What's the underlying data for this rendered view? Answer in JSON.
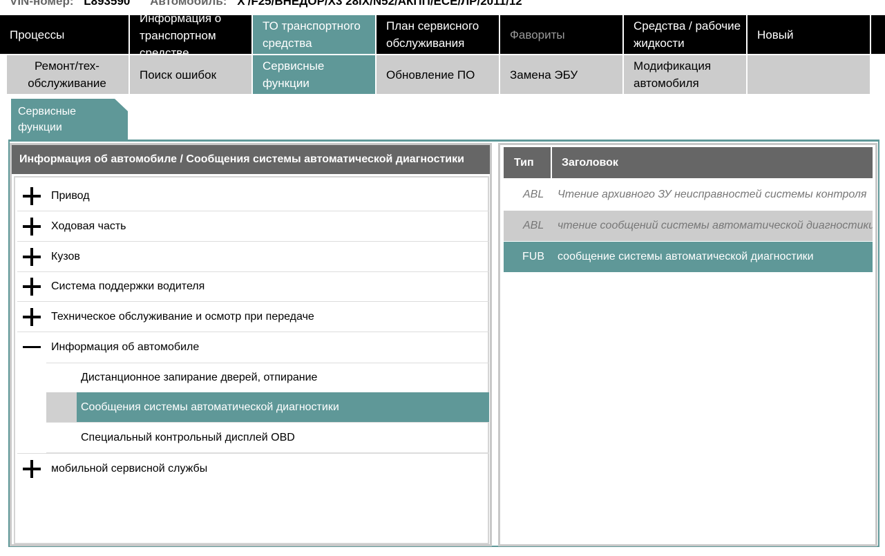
{
  "vin": {
    "label": "VIN-номер:",
    "value": "L893590",
    "car_label": "Автомобиль:",
    "car_value": "X'/F25/ВНЕДОР/X3 28iX/N52/АКПП/ЕСЕ/ЛР/2011/12"
  },
  "nav_top": {
    "processes": "Процессы",
    "vehicle_info": "Информация о транспортном средстве",
    "vehicle_service": "ТО транспортного средства",
    "service_plan": "План сервисного обслуживания",
    "favorites": "Фавориты",
    "fluids": "Средства / рабочие жидкости",
    "new": "Новый"
  },
  "nav_sub": {
    "repair": "Ремонт/тех-обслуживание",
    "fault_search": "Поиск ошибок",
    "service_functions": "Сервисные функции",
    "software_update": "Обновление ПО",
    "ecu_replacement": "Замена ЭБУ",
    "vehicle_modification": "Модификация автомобиля"
  },
  "subtab": {
    "label": "Сервисные функции"
  },
  "left_panel": {
    "header": "Информация об автомобиле / Сообщения системы автоматической диагностики",
    "tree": {
      "drive": "Привод",
      "chassis": "Ходовая часть",
      "body": "Кузов",
      "driver_assist": "Система поддержки водителя",
      "maintenance": "Техническое обслуживание и осмотр при передаче",
      "vehicle_info": "Информация об автомобиле",
      "remote_locking": "Дистанционное запирание дверей, отпирание",
      "diag_messages": "Сообщения системы автоматической диагностики",
      "obd_display": "Специальный контрольный дисплей OBD",
      "mobile_service": "мобильной сервисной службы"
    }
  },
  "right_panel": {
    "col_type": "Тип",
    "col_title": "Заголовок",
    "rows": [
      {
        "type": "ABL",
        "title": "Чтение архивного ЗУ неисправностей системы контроля"
      },
      {
        "type": "ABL",
        "title": "чтение сообщений системы автоматической диагностики"
      },
      {
        "type": "FUB",
        "title": "сообщение системы автоматической диагностики"
      }
    ]
  },
  "colors": {
    "accent": "#5f9898",
    "header_grey": "#666666",
    "tab_grey": "#cccccc",
    "nav_black": "#000000"
  }
}
